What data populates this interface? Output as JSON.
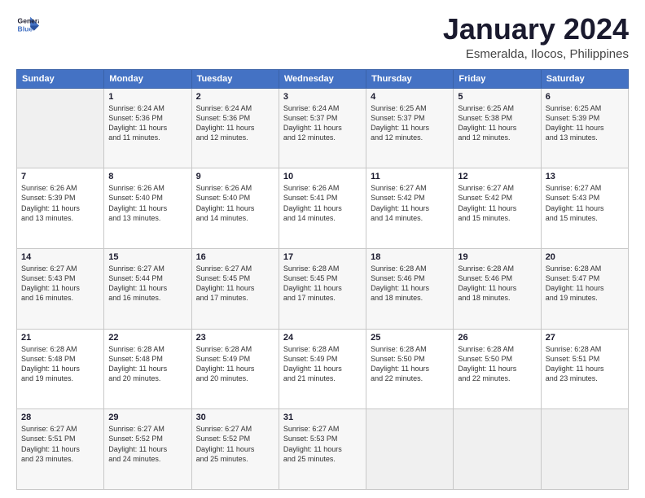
{
  "logo": {
    "line1": "General",
    "line2": "Blue"
  },
  "title": "January 2024",
  "location": "Esmeralda, Ilocos, Philippines",
  "days_of_week": [
    "Sunday",
    "Monday",
    "Tuesday",
    "Wednesday",
    "Thursday",
    "Friday",
    "Saturday"
  ],
  "weeks": [
    [
      {
        "day": "",
        "info": ""
      },
      {
        "day": "1",
        "info": "Sunrise: 6:24 AM\nSunset: 5:36 PM\nDaylight: 11 hours\nand 11 minutes."
      },
      {
        "day": "2",
        "info": "Sunrise: 6:24 AM\nSunset: 5:36 PM\nDaylight: 11 hours\nand 12 minutes."
      },
      {
        "day": "3",
        "info": "Sunrise: 6:24 AM\nSunset: 5:37 PM\nDaylight: 11 hours\nand 12 minutes."
      },
      {
        "day": "4",
        "info": "Sunrise: 6:25 AM\nSunset: 5:37 PM\nDaylight: 11 hours\nand 12 minutes."
      },
      {
        "day": "5",
        "info": "Sunrise: 6:25 AM\nSunset: 5:38 PM\nDaylight: 11 hours\nand 12 minutes."
      },
      {
        "day": "6",
        "info": "Sunrise: 6:25 AM\nSunset: 5:39 PM\nDaylight: 11 hours\nand 13 minutes."
      }
    ],
    [
      {
        "day": "7",
        "info": "Sunrise: 6:26 AM\nSunset: 5:39 PM\nDaylight: 11 hours\nand 13 minutes."
      },
      {
        "day": "8",
        "info": "Sunrise: 6:26 AM\nSunset: 5:40 PM\nDaylight: 11 hours\nand 13 minutes."
      },
      {
        "day": "9",
        "info": "Sunrise: 6:26 AM\nSunset: 5:40 PM\nDaylight: 11 hours\nand 14 minutes."
      },
      {
        "day": "10",
        "info": "Sunrise: 6:26 AM\nSunset: 5:41 PM\nDaylight: 11 hours\nand 14 minutes."
      },
      {
        "day": "11",
        "info": "Sunrise: 6:27 AM\nSunset: 5:42 PM\nDaylight: 11 hours\nand 14 minutes."
      },
      {
        "day": "12",
        "info": "Sunrise: 6:27 AM\nSunset: 5:42 PM\nDaylight: 11 hours\nand 15 minutes."
      },
      {
        "day": "13",
        "info": "Sunrise: 6:27 AM\nSunset: 5:43 PM\nDaylight: 11 hours\nand 15 minutes."
      }
    ],
    [
      {
        "day": "14",
        "info": "Sunrise: 6:27 AM\nSunset: 5:43 PM\nDaylight: 11 hours\nand 16 minutes."
      },
      {
        "day": "15",
        "info": "Sunrise: 6:27 AM\nSunset: 5:44 PM\nDaylight: 11 hours\nand 16 minutes."
      },
      {
        "day": "16",
        "info": "Sunrise: 6:27 AM\nSunset: 5:45 PM\nDaylight: 11 hours\nand 17 minutes."
      },
      {
        "day": "17",
        "info": "Sunrise: 6:28 AM\nSunset: 5:45 PM\nDaylight: 11 hours\nand 17 minutes."
      },
      {
        "day": "18",
        "info": "Sunrise: 6:28 AM\nSunset: 5:46 PM\nDaylight: 11 hours\nand 18 minutes."
      },
      {
        "day": "19",
        "info": "Sunrise: 6:28 AM\nSunset: 5:46 PM\nDaylight: 11 hours\nand 18 minutes."
      },
      {
        "day": "20",
        "info": "Sunrise: 6:28 AM\nSunset: 5:47 PM\nDaylight: 11 hours\nand 19 minutes."
      }
    ],
    [
      {
        "day": "21",
        "info": "Sunrise: 6:28 AM\nSunset: 5:48 PM\nDaylight: 11 hours\nand 19 minutes."
      },
      {
        "day": "22",
        "info": "Sunrise: 6:28 AM\nSunset: 5:48 PM\nDaylight: 11 hours\nand 20 minutes."
      },
      {
        "day": "23",
        "info": "Sunrise: 6:28 AM\nSunset: 5:49 PM\nDaylight: 11 hours\nand 20 minutes."
      },
      {
        "day": "24",
        "info": "Sunrise: 6:28 AM\nSunset: 5:49 PM\nDaylight: 11 hours\nand 21 minutes."
      },
      {
        "day": "25",
        "info": "Sunrise: 6:28 AM\nSunset: 5:50 PM\nDaylight: 11 hours\nand 22 minutes."
      },
      {
        "day": "26",
        "info": "Sunrise: 6:28 AM\nSunset: 5:50 PM\nDaylight: 11 hours\nand 22 minutes."
      },
      {
        "day": "27",
        "info": "Sunrise: 6:28 AM\nSunset: 5:51 PM\nDaylight: 11 hours\nand 23 minutes."
      }
    ],
    [
      {
        "day": "28",
        "info": "Sunrise: 6:27 AM\nSunset: 5:51 PM\nDaylight: 11 hours\nand 23 minutes."
      },
      {
        "day": "29",
        "info": "Sunrise: 6:27 AM\nSunset: 5:52 PM\nDaylight: 11 hours\nand 24 minutes."
      },
      {
        "day": "30",
        "info": "Sunrise: 6:27 AM\nSunset: 5:52 PM\nDaylight: 11 hours\nand 25 minutes."
      },
      {
        "day": "31",
        "info": "Sunrise: 6:27 AM\nSunset: 5:53 PM\nDaylight: 11 hours\nand 25 minutes."
      },
      {
        "day": "",
        "info": ""
      },
      {
        "day": "",
        "info": ""
      },
      {
        "day": "",
        "info": ""
      }
    ]
  ]
}
